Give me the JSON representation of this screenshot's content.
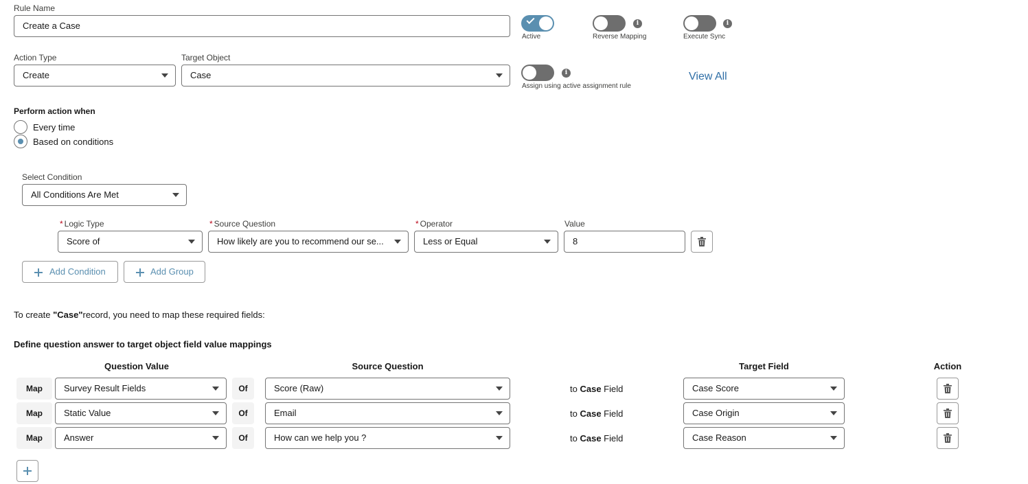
{
  "rule_name": {
    "label": "Rule Name",
    "value": "Create a Case"
  },
  "toggles": {
    "active": "Active",
    "reverse_mapping": "Reverse Mapping",
    "execute_sync": "Execute Sync",
    "assign_rule": "Assign using active assignment rule"
  },
  "action_type": {
    "label": "Action Type",
    "value": "Create"
  },
  "target_object": {
    "label": "Target Object",
    "value": "Case"
  },
  "view_all": "View All",
  "perform": {
    "label": "Perform action when",
    "every_time": "Every time",
    "based_on": "Based on conditions"
  },
  "select_condition": {
    "label": "Select Condition",
    "value": "All Conditions Are Met"
  },
  "condition": {
    "logic_type_label": "Logic Type",
    "logic_type": "Score of",
    "source_question_label": "Source Question",
    "source_question": "How likely are you to recommend our se...",
    "operator_label": "Operator",
    "operator": "Less or Equal",
    "value_label": "Value",
    "value": "8"
  },
  "buttons": {
    "add_condition": "Add Condition",
    "add_group": "Add Group"
  },
  "required_note": {
    "prefix": "To create ",
    "object": "\"Case\"",
    "suffix": "record, you need to map these required fields:"
  },
  "mapping_title": "Define question answer to target object field value mappings",
  "columns": {
    "question_value": "Question Value",
    "source_question": "Source Question",
    "target_field": "Target Field",
    "action": "Action"
  },
  "row_words": {
    "map": "Map",
    "of": "Of",
    "to": "to",
    "object": "Case",
    "field": "Field"
  },
  "mappings": [
    {
      "question_value": "Survey Result Fields",
      "source": "Score (Raw)",
      "target": "Case Score"
    },
    {
      "question_value": "Static Value",
      "source": "Email",
      "target": "Case Origin"
    },
    {
      "question_value": "Answer",
      "source": "How can we help you ?",
      "target": "Case Reason"
    }
  ],
  "colors": {
    "accent": "#5a8fb0",
    "toggle_off": "#6e6e6e",
    "link": "#2e6ea6"
  }
}
